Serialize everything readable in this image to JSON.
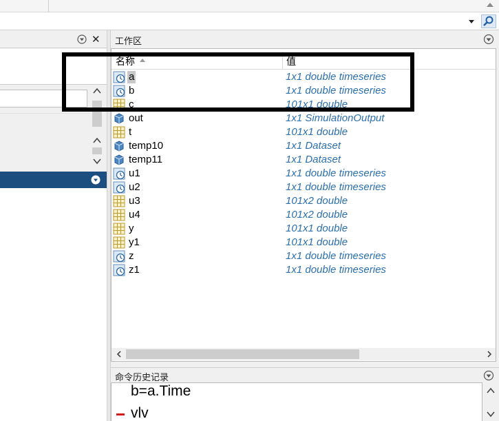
{
  "workspace": {
    "title": "工作区",
    "columns": {
      "name": "名称",
      "value": "值"
    },
    "variables": [
      {
        "name": "a",
        "value": "1x1 double timeseries",
        "icon": "timeseries-icon",
        "selected": true
      },
      {
        "name": "b",
        "value": "1x1 double timeseries",
        "icon": "timeseries-icon"
      },
      {
        "name": "c",
        "value": "101x1 double",
        "icon": "matrix-icon"
      },
      {
        "name": "out",
        "value": "1x1 SimulationOutput",
        "icon": "object-icon"
      },
      {
        "name": "t",
        "value": "101x1 double",
        "icon": "matrix-icon"
      },
      {
        "name": "temp10",
        "value": "1x1 Dataset",
        "icon": "object-icon"
      },
      {
        "name": "temp11",
        "value": "1x1 Dataset",
        "icon": "object-icon"
      },
      {
        "name": "u1",
        "value": "1x1 double timeseries",
        "icon": "timeseries-icon"
      },
      {
        "name": "u2",
        "value": "1x1 double timeseries",
        "icon": "timeseries-icon"
      },
      {
        "name": "u3",
        "value": "101x2 double",
        "icon": "matrix-icon"
      },
      {
        "name": "u4",
        "value": "101x2 double",
        "icon": "matrix-icon"
      },
      {
        "name": "y",
        "value": "101x1 double",
        "icon": "matrix-icon"
      },
      {
        "name": "y1",
        "value": "101x1 double",
        "icon": "matrix-icon"
      },
      {
        "name": "z",
        "value": "1x1 double timeseries",
        "icon": "timeseries-icon"
      },
      {
        "name": "z1",
        "value": "1x1 double timeseries",
        "icon": "timeseries-icon"
      }
    ]
  },
  "command_history": {
    "title": "命令历史记录",
    "lines": [
      "b=a.Time",
      "vlv"
    ]
  },
  "left_panel": {
    "close_glyph": "✕"
  },
  "colors": {
    "accent_blue": "#1c4e80",
    "value_text": "#2c6fad",
    "history_marker": "#d41a1a",
    "annotation_box": "#000000"
  }
}
